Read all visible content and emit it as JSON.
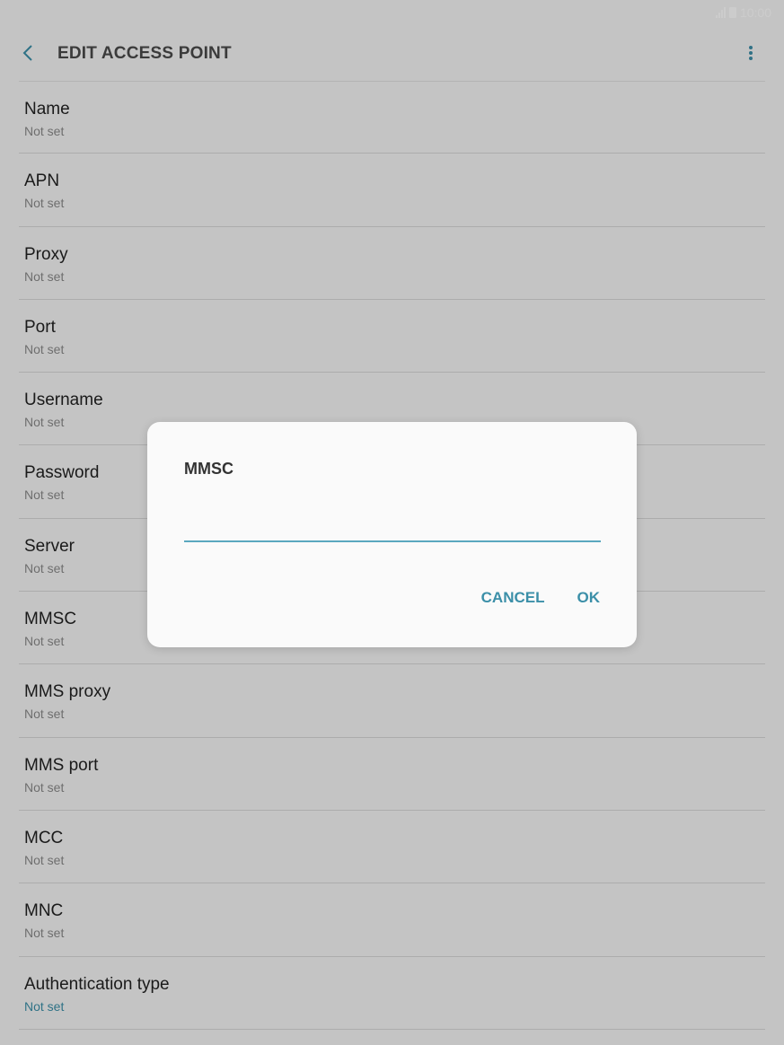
{
  "status_bar": {
    "time": "10:00"
  },
  "app_bar": {
    "title": "EDIT ACCESS POINT"
  },
  "colors": {
    "accent": "#3b8fa8",
    "overlay": "rgba(0,0,0,0.2)"
  },
  "icons": [
    "back-icon",
    "more-options-icon",
    "signal-icon",
    "battery-icon"
  ],
  "settings": [
    {
      "label": "Name",
      "value": "Not set"
    },
    {
      "label": "APN",
      "value": "Not set"
    },
    {
      "label": "Proxy",
      "value": "Not set"
    },
    {
      "label": "Port",
      "value": "Not set"
    },
    {
      "label": "Username",
      "value": "Not set"
    },
    {
      "label": "Password",
      "value": "Not set"
    },
    {
      "label": "Server",
      "value": "Not set"
    },
    {
      "label": "MMSC",
      "value": "Not set"
    },
    {
      "label": "MMS proxy",
      "value": "Not set"
    },
    {
      "label": "MMS port",
      "value": "Not set"
    },
    {
      "label": "MCC",
      "value": "Not set"
    },
    {
      "label": "MNC",
      "value": "Not set"
    },
    {
      "label": "Authentication type",
      "value": "Not set"
    }
  ],
  "dialog": {
    "title": "MMSC",
    "input_value": "",
    "cancel_label": "CANCEL",
    "ok_label": "OK"
  }
}
